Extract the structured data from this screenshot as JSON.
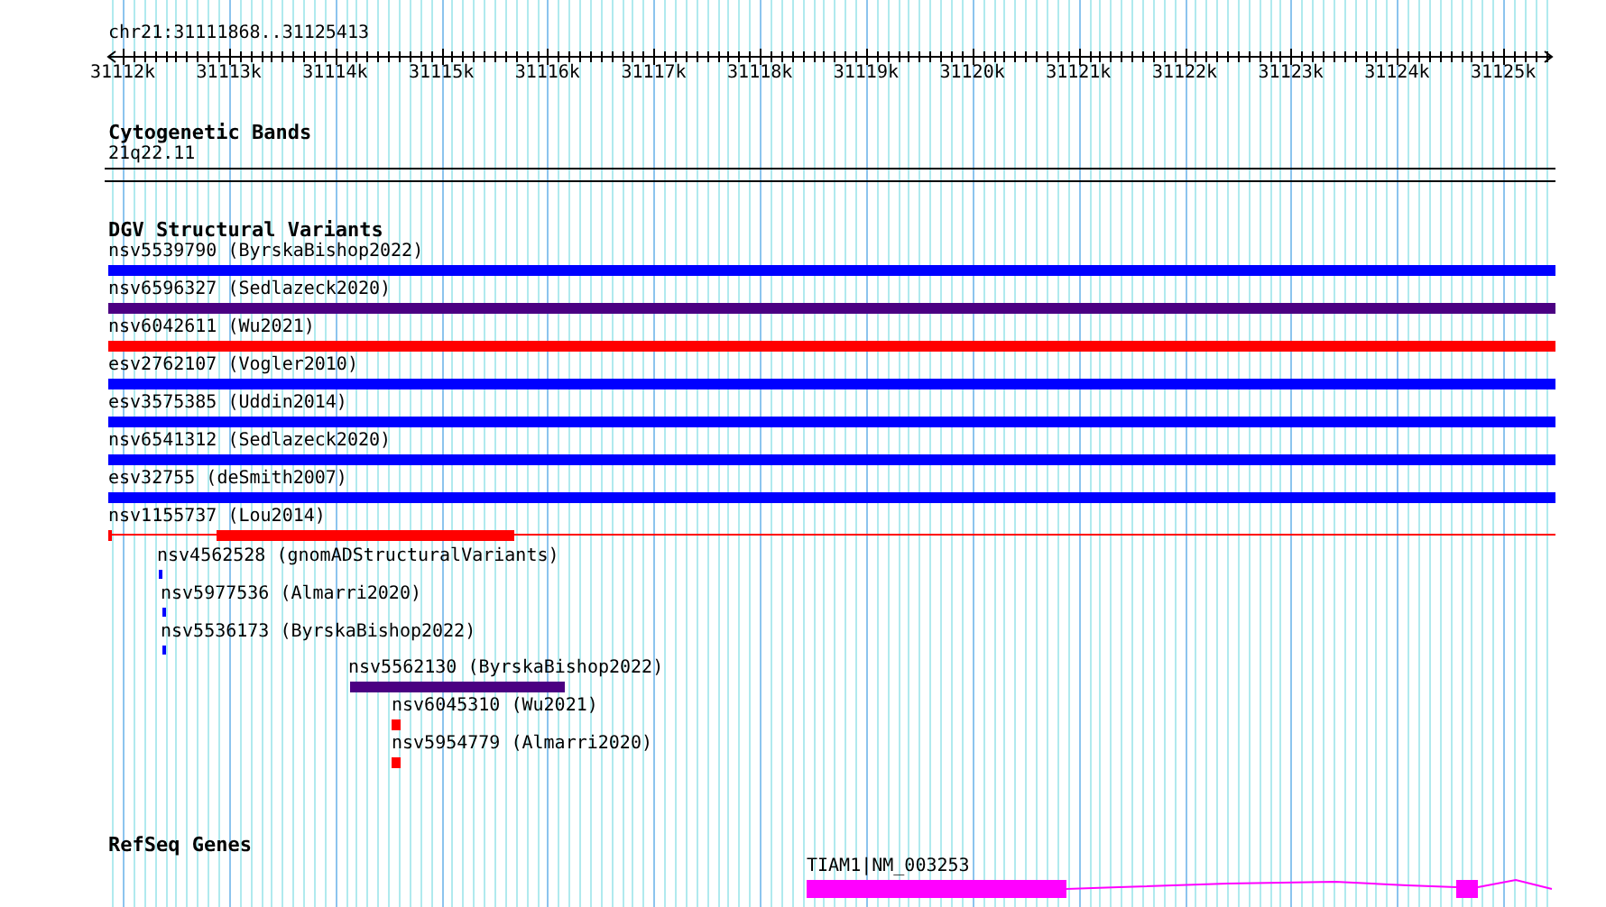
{
  "location": "chr21:31111868..31125413",
  "ruler": {
    "ticks": [
      "31112k",
      "31113k",
      "31114k",
      "31115k",
      "31116k",
      "31117k",
      "31118k",
      "31119k",
      "31120k",
      "31121k",
      "31122k",
      "31123k",
      "31124k",
      "31125k"
    ]
  },
  "tracks": [
    {
      "kind": "cytoband",
      "title": "Cytogenetic Bands",
      "features": [
        {
          "label": "21q22.11"
        }
      ]
    },
    {
      "kind": "variants",
      "title": "DGV Structural Variants",
      "features": [
        {
          "label": "nsv5539790 (ByrskaBishop2022)",
          "color": "#0000ff"
        },
        {
          "label": "nsv6596327 (Sedlazeck2020)",
          "color": "#4b0082"
        },
        {
          "label": "nsv6042611 (Wu2021)",
          "color": "#ff0000"
        },
        {
          "label": "esv2762107 (Vogler2010)",
          "color": "#0000ff"
        },
        {
          "label": "esv3575385 (Uddin2014)",
          "color": "#0000ff"
        },
        {
          "label": "nsv6541312 (Sedlazeck2020)",
          "color": "#0000ff"
        },
        {
          "label": "esv32755 (deSmith2007)",
          "color": "#0000ff"
        },
        {
          "label": "nsv1155737 (Lou2014)",
          "color": "#ff0000"
        },
        {
          "label": "nsv4562528 (gnomADStructuralVariants)",
          "color": "#0000ff"
        },
        {
          "label": "nsv5977536 (Almarri2020)",
          "color": "#0000ff"
        },
        {
          "label": "nsv5536173 (ByrskaBishop2022)",
          "color": "#0000ff"
        },
        {
          "label": "nsv5562130 (ByrskaBishop2022)",
          "color": "#4b0082"
        },
        {
          "label": "nsv6045310 (Wu2021)",
          "color": "#ff0000"
        },
        {
          "label": "nsv5954779 (Almarri2020)",
          "color": "#ff0000"
        }
      ]
    },
    {
      "kind": "genes",
      "title": "RefSeq Genes",
      "features": [
        {
          "label": "TIAM1|NM_003253",
          "color": "#ff00ff"
        }
      ]
    }
  ]
}
